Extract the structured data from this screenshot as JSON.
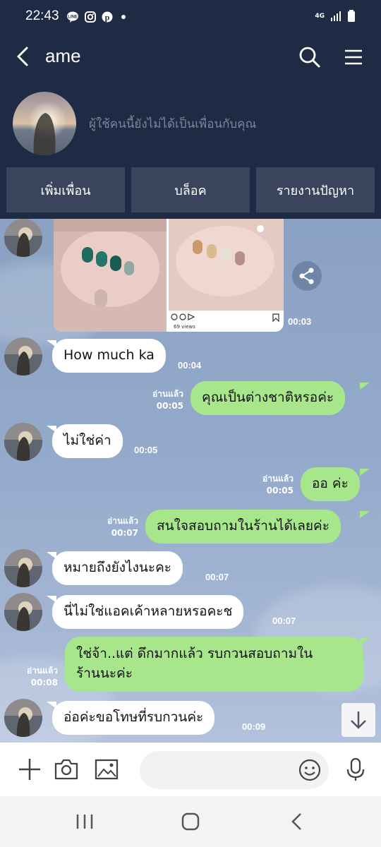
{
  "status_bar": {
    "time": "22:43",
    "icons": [
      "line-icon",
      "instagram-icon",
      "pinterest-icon",
      "dot-icon"
    ],
    "network": "4G"
  },
  "header": {
    "title": "ame"
  },
  "profile": {
    "note": "ผู้ใช้คนนี้ยังไม่ได้เป็นเพื่อนกับคุณ"
  },
  "actions": {
    "add_friend": "เพิ่มเพื่อน",
    "block": "บล็อค",
    "report": "รายงานปัญหา"
  },
  "photo_message": {
    "views_label": "69 views",
    "time": "00:03"
  },
  "messages": [
    {
      "dir": "in",
      "text": "How much ka",
      "time": "00:04"
    },
    {
      "dir": "out",
      "text": "คุณเป็นต่างชาติหรอค่ะ",
      "time": "00:05",
      "read": "อ่านแล้ว"
    },
    {
      "dir": "in",
      "text": "ไม่ใช่ค่า",
      "time": "00:05"
    },
    {
      "dir": "out",
      "text": "ออ ค่ะ",
      "time": "00:05",
      "read": "อ่านแล้ว"
    },
    {
      "dir": "out",
      "text": "สนใจสอบถามในร้านได้เลยค่ะ",
      "time": "00:07",
      "read": "อ่านแล้ว"
    },
    {
      "dir": "in",
      "text": "หมายถึงยังไงนะคะ",
      "time": "00:07"
    },
    {
      "dir": "in",
      "text": "นี่ไม่ใช่แอคเค้าหลายหรอคะช",
      "time": "00:07"
    },
    {
      "dir": "out",
      "text_line1": "ใช่จ้า..แต่ ดึกมากแล้ว รบกวนสอบถามใน",
      "text_line2": "ร้านนะค่ะ",
      "time": "00:08",
      "read": "อ่านแล้ว"
    },
    {
      "dir": "in",
      "text": "อ่อค่ะขอโทษที่รบกวนค่ะ",
      "time": "00:09"
    }
  ],
  "input": {
    "placeholder": ""
  },
  "colors": {
    "header_bg": "#1f2a44",
    "out_bubble": "#a7e68b",
    "in_bubble": "#ffffff",
    "button_bg": "#3a455d"
  }
}
